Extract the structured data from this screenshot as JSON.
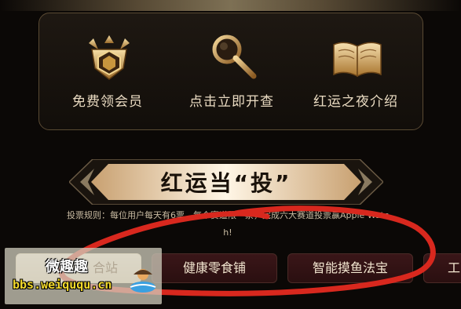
{
  "features": [
    {
      "label": "免费领会员",
      "icon": "vip-badge-icon"
    },
    {
      "label": "点击立即开查",
      "icon": "magnifier-icon"
    },
    {
      "label": "红运之夜介绍",
      "icon": "open-book-icon"
    }
  ],
  "banner": {
    "title": "红运当“投”"
  },
  "rules": {
    "line1": "投票规则：每位用户每天有6票，每个赛道限一票，完成六大赛道投票赢Apple Watc",
    "line2": "h!"
  },
  "tabs": [
    {
      "label": "合站",
      "active": true
    },
    {
      "label": "健康零食铺",
      "active": false
    },
    {
      "label": "智能摸鱼法宝",
      "active": false
    },
    {
      "label": "工",
      "active": false
    }
  ],
  "watermark": {
    "title": "微趣趣",
    "url": "bbs.weiququ.cn"
  },
  "colors": {
    "accent_red": "#d8281e",
    "gold": "#d9b46a",
    "tab_dark": "#2a0f10"
  }
}
